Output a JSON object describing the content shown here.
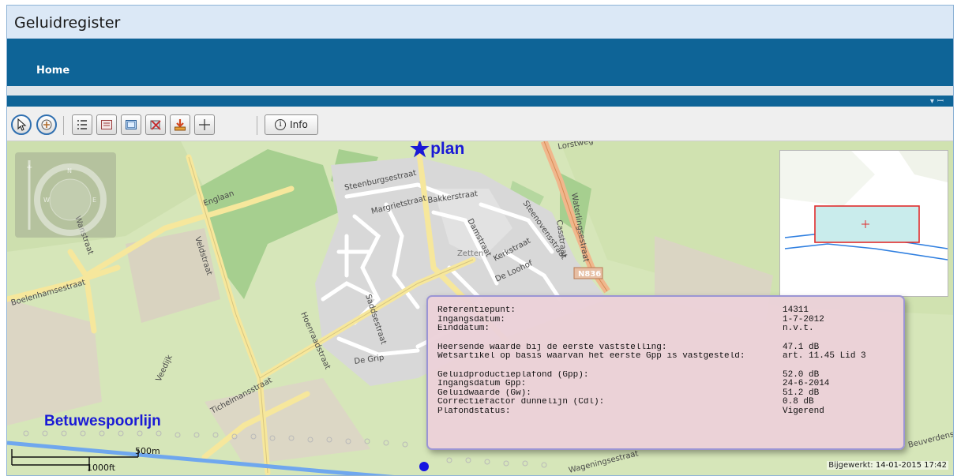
{
  "app": {
    "title": "Geluidregister"
  },
  "nav": {
    "home": "Home"
  },
  "toolbar": {
    "buttons": [
      {
        "icon": "pointer-icon"
      },
      {
        "icon": "pan-icon"
      },
      {
        "icon": "legend-icon"
      },
      {
        "icon": "layers-icon"
      },
      {
        "icon": "map-view-icon"
      },
      {
        "icon": "clear-icon"
      },
      {
        "icon": "download-icon"
      },
      {
        "icon": "crosshair-icon"
      }
    ],
    "info_label": "Info"
  },
  "map": {
    "plan_label": "plan",
    "railway_label": "Betuwespoorlijn",
    "road_badge": "N836",
    "streets": [
      "Steenburgsestraat",
      "Bakkerstraat",
      "Margrietstraat",
      "Damstraat",
      "Steenovensstraat",
      "Casstraat",
      "Waterlingsestraat",
      "Kerkstraat",
      "Zetten",
      "De Loohof",
      "Englaan",
      "Veldstraat",
      "Wanstraat",
      "Boelenhamsestraat",
      "Hoenraadstraat",
      "Saddsestraat",
      "De Grip",
      "Veedijk",
      "Tichelmansstraat",
      "Wageningsestraat",
      "Beuverdense",
      "Lorstweg"
    ],
    "scale": {
      "metric": "500m",
      "imperial": "1000ft"
    },
    "updated_label": "Bijgewerkt:",
    "updated_value": "14-01-2015 17:42"
  },
  "info": {
    "rows_1": [
      {
        "key": "Referentiepunt:",
        "value": "14311"
      },
      {
        "key": "Ingangsdatum:",
        "value": "1-7-2012"
      },
      {
        "key": "Einddatum:",
        "value": "n.v.t."
      }
    ],
    "rows_2": [
      {
        "key": "Heersende waarde bij de eerste vaststelling:",
        "value": "47.1 dB"
      },
      {
        "key": "Wetsartikel op basis waarvan het eerste Gpp is vastgesteld:",
        "value": "art. 11.45 Lid 3"
      }
    ],
    "rows_3": [
      {
        "key": "Geluidproductieplafond (Gpp):",
        "value": "52.0 dB"
      },
      {
        "key": "Ingangsdatum Gpp:",
        "value": "24-6-2014"
      },
      {
        "key": "Geluidwaarde (Gw):",
        "value": "51.2 dB"
      },
      {
        "key": "Correctiefactor dunnelijn (Cdl):",
        "value": "0.8 dB"
      },
      {
        "key": "Plafondstatus:",
        "value": "Vigerend"
      }
    ]
  },
  "colors": {
    "nav": "#0e6497",
    "label": "#1a1ad6",
    "rail": "#6fa7ee",
    "infobox_border": "#9b95d4"
  }
}
